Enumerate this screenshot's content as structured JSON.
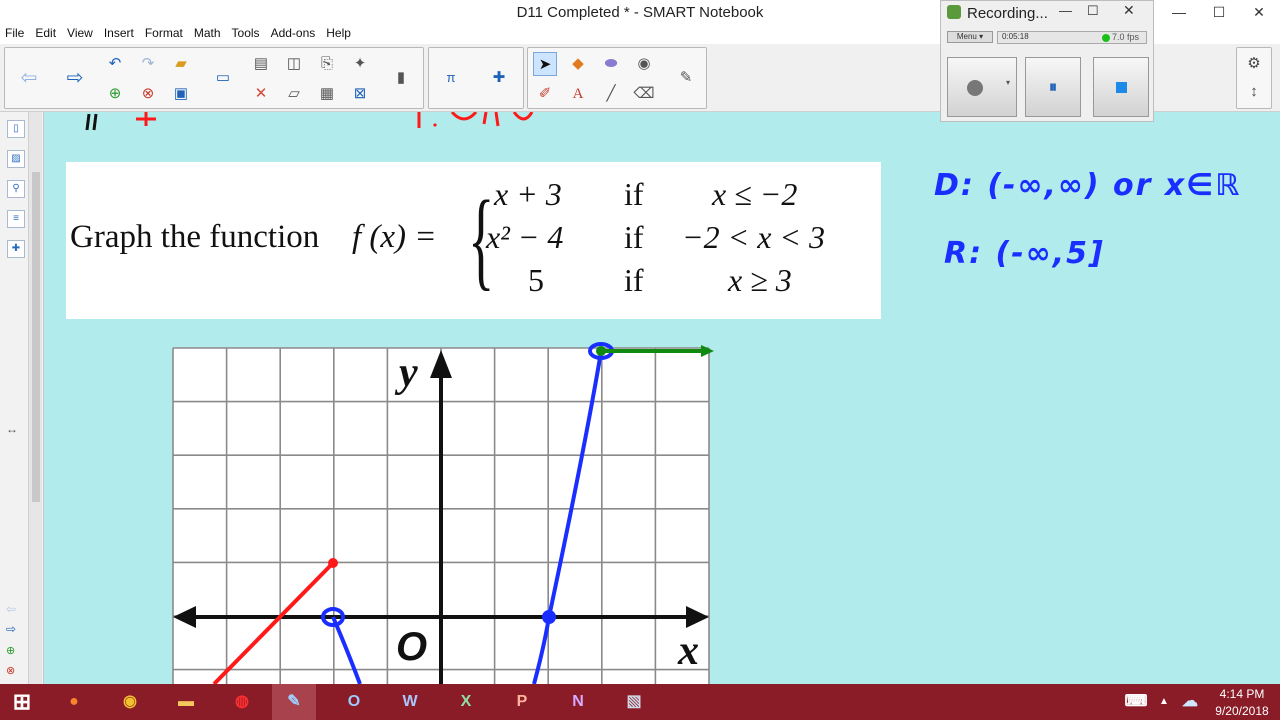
{
  "window": {
    "title": "D11 Completed * - SMART Notebook",
    "min": "—",
    "max": "☐",
    "close": "✕"
  },
  "menu": [
    "File",
    "Edit",
    "View",
    "Insert",
    "Format",
    "Math",
    "Tools",
    "Add-ons",
    "Help"
  ],
  "recorder": {
    "title": "Recording...",
    "menu_label": "Menu",
    "timer": "0:05:18",
    "fps": "7.0 fps"
  },
  "problem": {
    "lead": "Graph the function",
    "fx": "f (x) =",
    "cases": [
      {
        "expr": "x + 3",
        "if": "if",
        "cond": "x ≤ −2"
      },
      {
        "expr": "x² − 4",
        "if": "if",
        "cond": "−2 < x < 3"
      },
      {
        "expr": "5",
        "if": "if",
        "cond": "x ≥ 3"
      }
    ]
  },
  "handwriting": {
    "domain": "D: (-∞,∞) or x∈ℝ",
    "range": "R: (-∞,5]"
  },
  "graph": {
    "y_label": "y",
    "x_label": "x",
    "origin_label": "O"
  },
  "taskbar": {
    "time": "4:14 PM",
    "date": "9/20/2018"
  },
  "colors": {
    "red_piece": "#ff1a1a",
    "blue_piece": "#1a2eff",
    "green_ray": "#118a11",
    "canvas": "#b2ebec",
    "taskbar": "#8a1c27"
  }
}
